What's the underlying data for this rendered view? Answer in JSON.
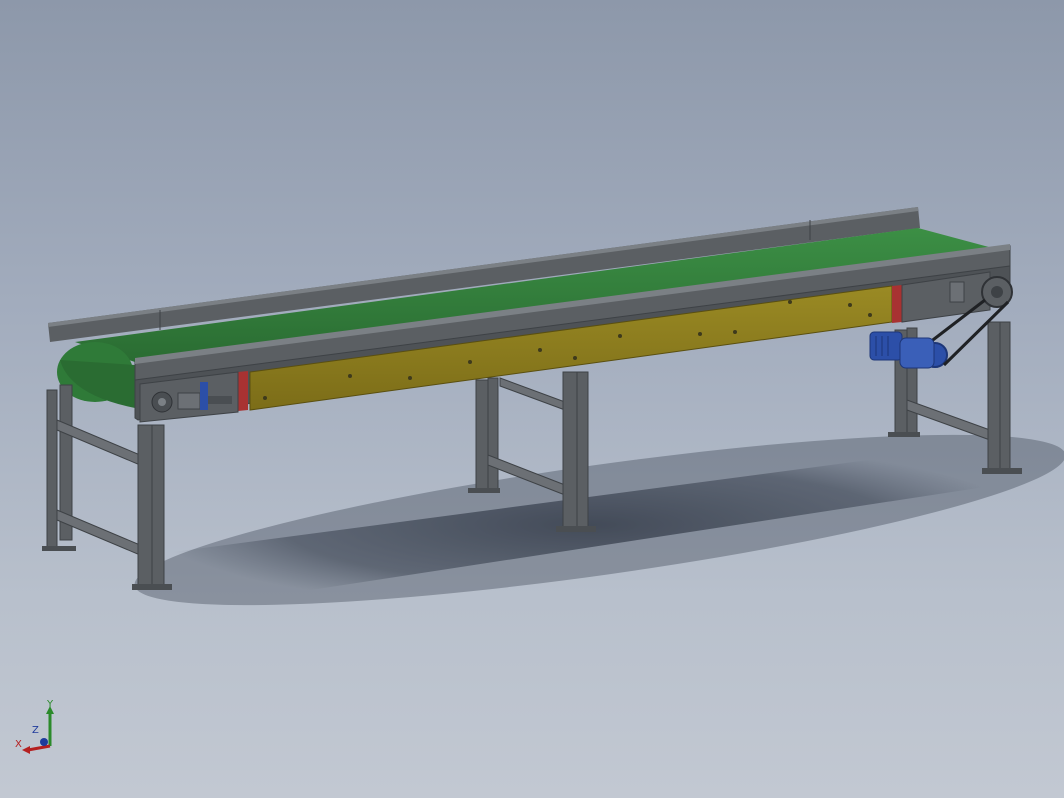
{
  "viewport": {
    "background_top": "#8d98aa",
    "background_bottom": "#c2c8d2"
  },
  "model": {
    "name": "belt-conveyor-assembly",
    "colors": {
      "frame": "#5b5f63",
      "frame_dark": "#3e4246",
      "frame_light": "#7b8085",
      "belt": "#2f7a38",
      "belt_light": "#3c8f45",
      "guard_panel": "#8a7a1e",
      "guard_panel_light": "#9a8a24",
      "motor": "#2c4fa8",
      "motor_dark": "#1d3678",
      "accent_red": "#a83232",
      "shadow": "#3a4250"
    }
  },
  "triad": {
    "x_label": "X",
    "y_label": "Y",
    "z_label": "Z",
    "x_color": "#b52020",
    "y_color": "#2b8a2b",
    "z_color": "#1f3b9c"
  }
}
